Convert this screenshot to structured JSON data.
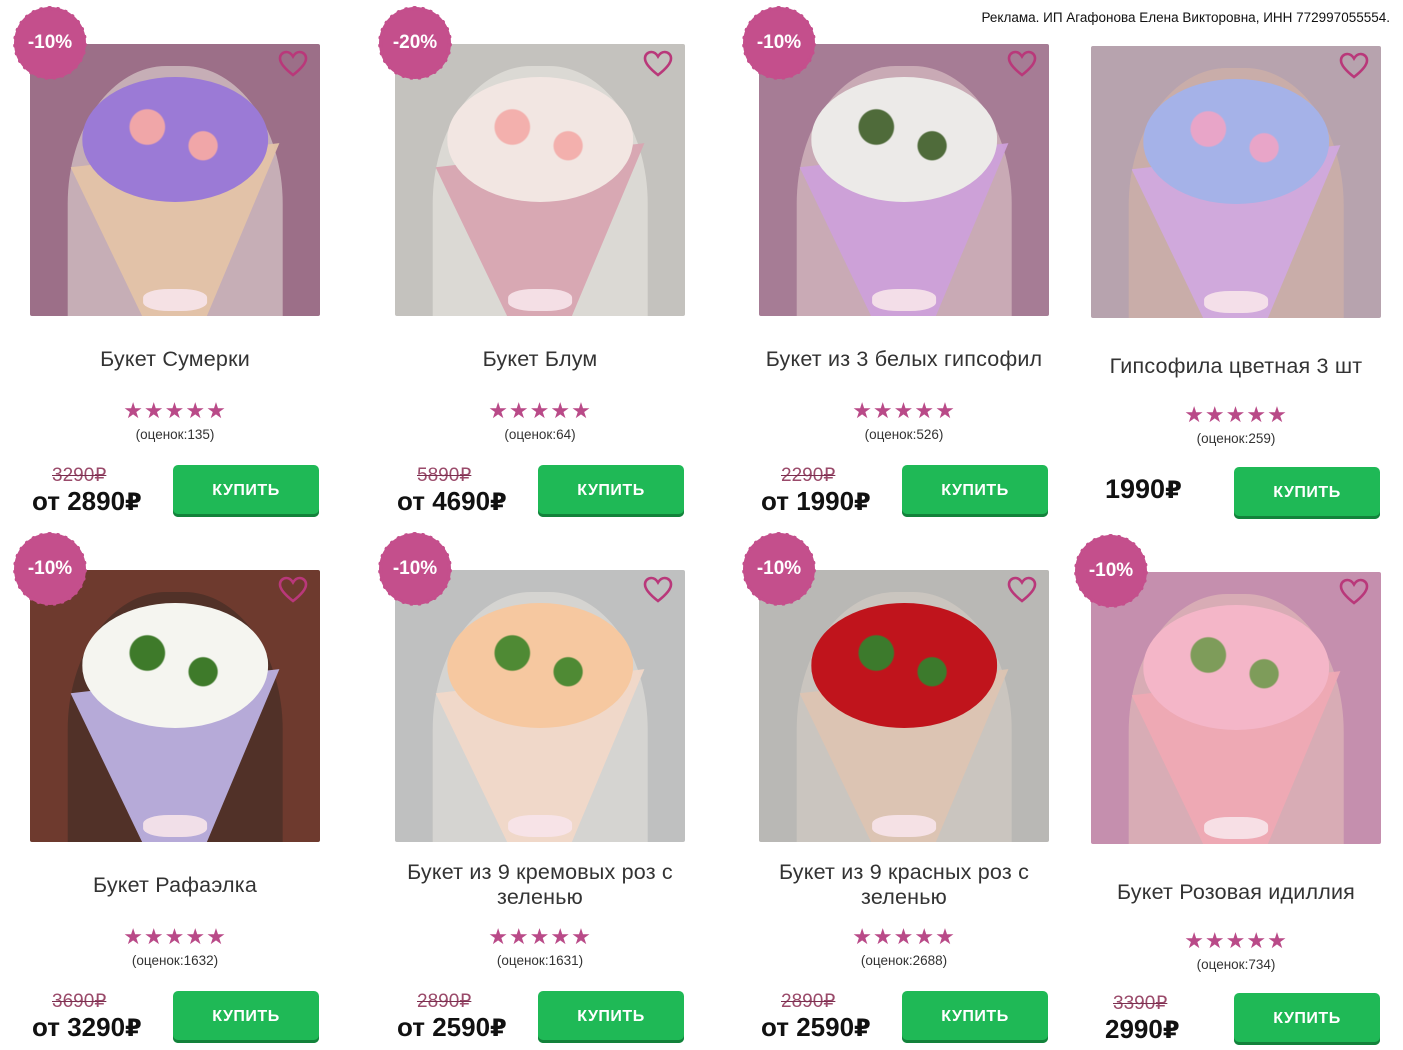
{
  "ad_note": "Реклама. ИП Агафонова Елена Викторовна, ИНН 772997055554.",
  "buy_label": "КУПИТЬ",
  "price_prefix": "от",
  "currency": "₽",
  "colors": {
    "badge": "#c44f8c",
    "stars": "#b94a88",
    "buy_button": "#1fb956",
    "heart": "#b9387a"
  },
  "products": [
    {
      "discount": "-10%",
      "title": "Букет Сумерки",
      "stars": "★★★★★",
      "rating": 4.5,
      "votes": "(оценок:135)",
      "old_price": "3290₽",
      "price": "2890",
      "has_prefix": true,
      "photo": {
        "bg": "#9c6f88",
        "person": "#e9e1dc",
        "wrap": "#e4c3a8",
        "blooms": "#9b7ad6",
        "accent": "#f0a6a8"
      }
    },
    {
      "discount": "-20%",
      "title": "Букет Блум",
      "stars": "★★★★★",
      "rating": 4.5,
      "votes": "(оценок:64)",
      "old_price": "5890₽",
      "price": "4690",
      "has_prefix": true,
      "photo": {
        "bg": "#c4c2be",
        "person": "#eeece6",
        "wrap": "#d8a5b1",
        "blooms": "#f2e6e2",
        "accent": "#f3b0ad"
      }
    },
    {
      "discount": "-10%",
      "title": "Букет из 3 белых гипсофил",
      "stars": "★★★★★",
      "rating": 4.5,
      "votes": "(оценок:526)",
      "old_price": "2290₽",
      "price": "1990",
      "has_prefix": true,
      "photo": {
        "bg": "#a67c95",
        "person": "#e6cfcf",
        "wrap": "#cea0da",
        "blooms": "#eceae8",
        "accent": "#4f6b3a"
      }
    },
    {
      "discount": "",
      "title": "Гипсофила цветная 3 шт",
      "stars": "★★★★★",
      "rating": 5,
      "votes": "(оценок:259)",
      "old_price": "",
      "price": "1990",
      "has_prefix": false,
      "photo": {
        "bg": "#b7a3ae",
        "person": "#d9b7a6",
        "wrap": "#d1a9de",
        "blooms": "#a5b2e8",
        "accent": "#e8a5c8"
      }
    },
    {
      "discount": "-10%",
      "title": "Букет Рафаэлка",
      "stars": "★★★★★",
      "rating": 4.5,
      "votes": "(оценок:1632)",
      "old_price": "3690₽",
      "price": "3290",
      "has_prefix": true,
      "photo": {
        "bg": "#6e3a2e",
        "person": "#3b2a24",
        "wrap": "#bcb1e2",
        "blooms": "#f5f5f0",
        "accent": "#3e7a2a"
      }
    },
    {
      "discount": "-10%",
      "title": "Букет из 9 кремовых роз с зеленью",
      "stars": "★★★★★",
      "rating": 4.5,
      "votes": "(оценок:1631)",
      "old_price": "2890₽",
      "price": "2590",
      "has_prefix": true,
      "photo": {
        "bg": "#bfc0c0",
        "person": "#e8e4df",
        "wrap": "#f1d8c8",
        "blooms": "#f6c8a0",
        "accent": "#4f8a34"
      }
    },
    {
      "discount": "-10%",
      "title": "Букет из 9 красных роз с зеленью",
      "stars": "★★★★★",
      "rating": 4.5,
      "votes": "(оценок:2688)",
      "old_price": "2890₽",
      "price": "2590",
      "has_prefix": true,
      "photo": {
        "bg": "#b9b8b5",
        "person": "#d8cfc6",
        "wrap": "#dcc4b2",
        "blooms": "#c0141c",
        "accent": "#3c7a2c"
      }
    },
    {
      "discount": "-10%",
      "title": "Букет Розовая идиллия",
      "stars": "★★★★★",
      "rating": 4.5,
      "votes": "(оценок:734)",
      "old_price": "3390₽",
      "price": "2990",
      "has_prefix": false,
      "photo": {
        "bg": "#c58fae",
        "person": "#e7c4bb",
        "wrap": "#efa9b4",
        "blooms": "#f4b6c8",
        "accent": "#7e9c5a"
      }
    }
  ]
}
